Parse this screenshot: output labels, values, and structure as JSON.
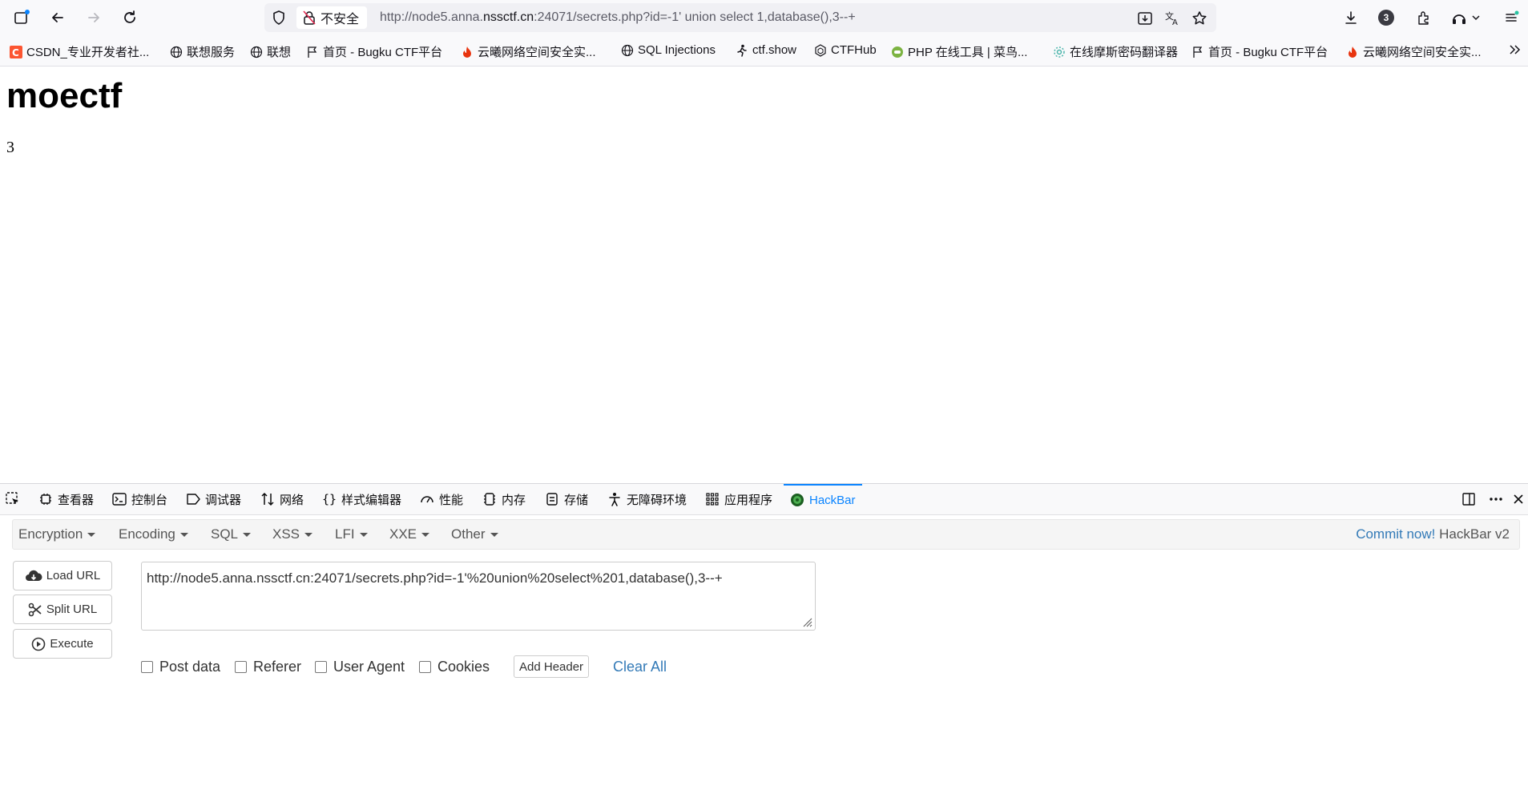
{
  "browser": {
    "insecure_label": "不安全",
    "url_prefix": "http://node5.anna.",
    "url_domain": "nssctf.cn",
    "url_suffix": ":24071/secrets.php?id=-1' union select 1,database(),3--+",
    "downloads_badge": "3"
  },
  "bookmarks": [
    {
      "label": "CSDN_专业开发者社...",
      "icon": "csdn-icon"
    },
    {
      "label": "联想服务",
      "icon": "globe-icon"
    },
    {
      "label": "联想",
      "icon": "globe-icon"
    },
    {
      "label": "首页 - Bugku CTF平台",
      "icon": "flag-icon"
    },
    {
      "label": "云曦网络空间安全实...",
      "icon": "fire-icon"
    },
    {
      "label": "SQL Injections",
      "icon": "globe-icon"
    },
    {
      "label": "ctf.show",
      "icon": "runner-icon"
    },
    {
      "label": "CTFHub",
      "icon": "hub-icon"
    },
    {
      "label": "PHP 在线工具 | 菜鸟...",
      "icon": "runoob-icon"
    },
    {
      "label": "在线摩斯密码翻译器",
      "icon": "gear-flower-icon"
    },
    {
      "label": "首页 - Bugku CTF平台",
      "icon": "flag-icon"
    },
    {
      "label": "云曦网络空间安全实...",
      "icon": "fire-icon"
    }
  ],
  "page": {
    "heading": "moectf",
    "output": "3"
  },
  "devtools": {
    "tabs": [
      "查看器",
      "控制台",
      "调试器",
      "网络",
      "样式编辑器",
      "性能",
      "内存",
      "存储",
      "无障碍环境",
      "应用程序",
      "HackBar"
    ],
    "active_tab": "HackBar"
  },
  "hackbar": {
    "menus": [
      "Encryption",
      "Encoding",
      "SQL",
      "XSS",
      "LFI",
      "XXE",
      "Other"
    ],
    "commit_link": "Commit now!",
    "version": "HackBar v2",
    "buttons": {
      "load": "Load URL",
      "split": "Split URL",
      "execute": "Execute"
    },
    "url_value": "http://node5.anna.nssctf.cn:24071/secrets.php?id=-1'%20union%20select%201,database(),3--+",
    "options": [
      "Post data",
      "Referer",
      "User Agent",
      "Cookies"
    ],
    "add_header": "Add Header",
    "clear_all": "Clear All"
  },
  "colors": {
    "accent": "#0a84ff",
    "link": "#337ab7"
  }
}
